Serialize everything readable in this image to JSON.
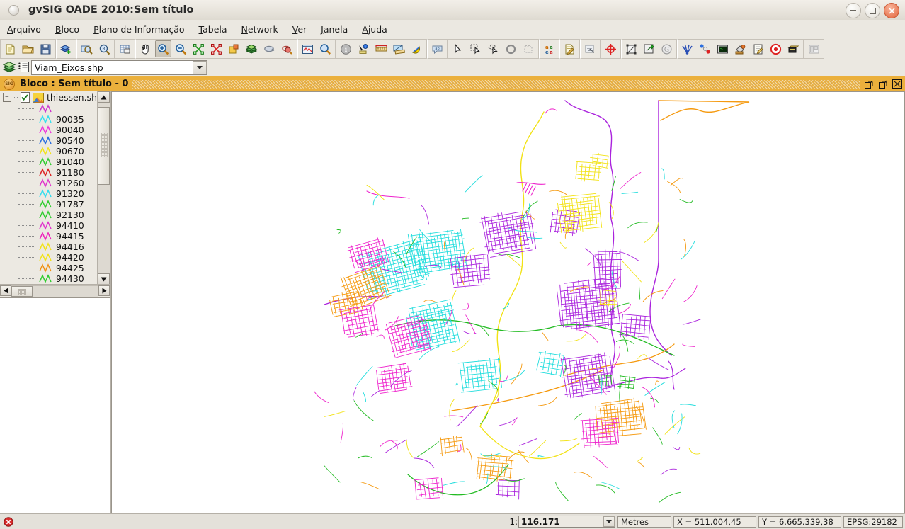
{
  "window": {
    "title": "gvSIG OADE 2010:Sem título",
    "app_icon": "circle-icon",
    "minimize": "−",
    "maximize": "□",
    "close": "×"
  },
  "menubar": {
    "items": [
      {
        "label": "Arquivo",
        "mnemonic": "A"
      },
      {
        "label": "Bloco",
        "mnemonic": "B"
      },
      {
        "label": "Plano de Informação",
        "mnemonic": "P"
      },
      {
        "label": "Tabela",
        "mnemonic": "T"
      },
      {
        "label": "Network",
        "mnemonic": "N"
      },
      {
        "label": "Ver",
        "mnemonic": "V"
      },
      {
        "label": "Janela",
        "mnemonic": "J"
      },
      {
        "label": "Ajuda",
        "mnemonic": "A"
      }
    ]
  },
  "toolbar": {
    "groups": [
      {
        "name": "file",
        "buttons": [
          {
            "icon": "new-document-icon",
            "selected": false
          },
          {
            "icon": "open-folder-icon",
            "selected": false
          },
          {
            "icon": "save-disk-icon",
            "selected": false
          }
        ]
      },
      {
        "name": "project",
        "buttons": [
          {
            "icon": "add-layer-icon",
            "selected": false
          }
        ]
      },
      {
        "name": "view-zoom",
        "buttons": [
          {
            "icon": "zoom-to-layer-icon",
            "selected": false
          },
          {
            "icon": "zoom-previous-icon",
            "selected": false
          }
        ]
      },
      {
        "name": "table",
        "buttons": [
          {
            "icon": "table-properties-icon",
            "selected": false
          }
        ]
      },
      {
        "name": "navigation",
        "buttons": [
          {
            "icon": "pan-hand-icon",
            "selected": false
          },
          {
            "icon": "zoom-in-icon",
            "selected": true
          },
          {
            "icon": "zoom-out-icon",
            "selected": false
          },
          {
            "icon": "zoom-full-extent-icon",
            "selected": false
          },
          {
            "icon": "zoom-selection-icon",
            "selected": false
          },
          {
            "icon": "frame-icon",
            "selected": false
          },
          {
            "icon": "layers-stack-icon",
            "selected": false
          },
          {
            "icon": "zoom-previous-view-icon",
            "selected": false
          },
          {
            "icon": "zoom-next-view-icon",
            "selected": false
          }
        ]
      },
      {
        "name": "locator",
        "buttons": [
          {
            "icon": "locator-map-icon",
            "selected": false
          },
          {
            "icon": "zoom-extent-icon",
            "selected": false
          }
        ]
      },
      {
        "name": "info-measure",
        "buttons": [
          {
            "icon": "info-icon",
            "selected": false
          },
          {
            "icon": "hyperlink-icon",
            "selected": false
          },
          {
            "icon": "measure-distance-icon",
            "selected": false
          },
          {
            "icon": "measure-area-icon",
            "selected": false
          },
          {
            "icon": "catalog-icon",
            "selected": false
          }
        ]
      },
      {
        "name": "annotation",
        "buttons": [
          {
            "icon": "speech-balloon-icon",
            "selected": false
          }
        ]
      },
      {
        "name": "selection",
        "buttons": [
          {
            "icon": "pointer-arrow-icon",
            "selected": false
          },
          {
            "icon": "select-by-rectangle-icon",
            "selected": false
          },
          {
            "icon": "select-by-polygon-icon",
            "selected": false
          },
          {
            "icon": "select-by-circle-icon",
            "selected": false
          },
          {
            "icon": "clear-selection-icon",
            "selected": false
          }
        ]
      },
      {
        "name": "geometry-edit",
        "buttons": [
          {
            "icon": "select-point-icon",
            "selected": false
          },
          {
            "icon": "select-node-icon",
            "selected": false
          },
          {
            "icon": "polygon-edit-icon",
            "selected": false
          },
          {
            "icon": "marquee-select-icon",
            "selected": false
          }
        ]
      },
      {
        "name": "labels",
        "buttons": [
          {
            "icon": "label-aea-icon",
            "selected": false
          }
        ]
      },
      {
        "name": "editing",
        "buttons": [
          {
            "icon": "edit-properties-icon",
            "selected": false
          }
        ]
      },
      {
        "name": "undo",
        "buttons": [
          {
            "icon": "undo-command-icon",
            "selected": false
          }
        ]
      },
      {
        "name": "center",
        "buttons": [
          {
            "icon": "crosshair-target-icon",
            "selected": false
          }
        ]
      },
      {
        "name": "raster",
        "buttons": [
          {
            "icon": "raster-transform-icon",
            "selected": false
          },
          {
            "icon": "export-raster-icon",
            "selected": false
          },
          {
            "icon": "georeference-icon",
            "selected": false
          }
        ]
      },
      {
        "name": "network-tools",
        "buttons": [
          {
            "icon": "network-fan-icon",
            "selected": false
          },
          {
            "icon": "molecule-network-icon",
            "selected": false
          },
          {
            "icon": "console-terminal-icon",
            "selected": false
          },
          {
            "icon": "paint-bucket-icon",
            "selected": false
          },
          {
            "icon": "edit-note-icon",
            "selected": false
          },
          {
            "icon": "target-record-icon",
            "selected": false
          },
          {
            "icon": "drawer-box-icon",
            "selected": false
          }
        ]
      },
      {
        "name": "layout",
        "buttons": [
          {
            "icon": "layout-panel-icon",
            "selected": false
          }
        ]
      }
    ]
  },
  "layer_combo": {
    "icon_left": "layers-stack-icon",
    "icon_right": "table-list-icon",
    "value": "Viam_Eixos.shp",
    "arrow": "chevron-down-icon"
  },
  "inner_frame": {
    "icon": "gvsig-globe-icon",
    "title": "Bloco : Sem título - 0",
    "buttons": [
      "restore-down-icon",
      "maximize-icon",
      "close-icon"
    ]
  },
  "toc": {
    "root": {
      "expander": "−",
      "checked": true,
      "icon": "shapefile-layer-icon",
      "label": "thiessen.sh"
    },
    "items": [
      {
        "label": "",
        "color": "#cc33cc"
      },
      {
        "label": "90035",
        "color": "#33e0ee"
      },
      {
        "label": "90040",
        "color": "#ee33dd"
      },
      {
        "label": "90540",
        "color": "#2a6ee0"
      },
      {
        "label": "90670",
        "color": "#f2e215"
      },
      {
        "label": "91040",
        "color": "#2fcc2f"
      },
      {
        "label": "91180",
        "color": "#dd2222"
      },
      {
        "label": "91260",
        "color": "#e033cc"
      },
      {
        "label": "91320",
        "color": "#33ddee"
      },
      {
        "label": "91787",
        "color": "#2fcc2f"
      },
      {
        "label": "92130",
        "color": "#2fcc2f"
      },
      {
        "label": "94410",
        "color": "#e033cc"
      },
      {
        "label": "94415",
        "color": "#ee22bb"
      },
      {
        "label": "94416",
        "color": "#f2e215"
      },
      {
        "label": "94420",
        "color": "#f2e215"
      },
      {
        "label": "94425",
        "color": "#f09010"
      },
      {
        "label": "94430",
        "color": "#2fcc2f"
      }
    ],
    "scrollbars": {
      "up": "triangle-up-icon",
      "down": "triangle-down-icon",
      "left": "triangle-left-icon",
      "right": "triangle-right-icon"
    }
  },
  "statusbar": {
    "error_icon": "error-badge-icon",
    "scale_prefix": "1:",
    "scale_value": "116.171",
    "scale_arrow": "chevron-down-icon",
    "units": "Metres",
    "coord_x": "X = 511.004,45",
    "coord_y": "Y = 6.665.339,38",
    "projection": "EPSG:29182"
  },
  "map": {
    "background": "#ffffff",
    "palette": {
      "magenta": "#ee22cc",
      "purple": "#aa22dd",
      "cyan": "#22dddd",
      "orange": "#f59a10",
      "yellow": "#f2e215",
      "green": "#22bb22",
      "red": "#dd2222",
      "blue": "#2a6ee0"
    }
  }
}
